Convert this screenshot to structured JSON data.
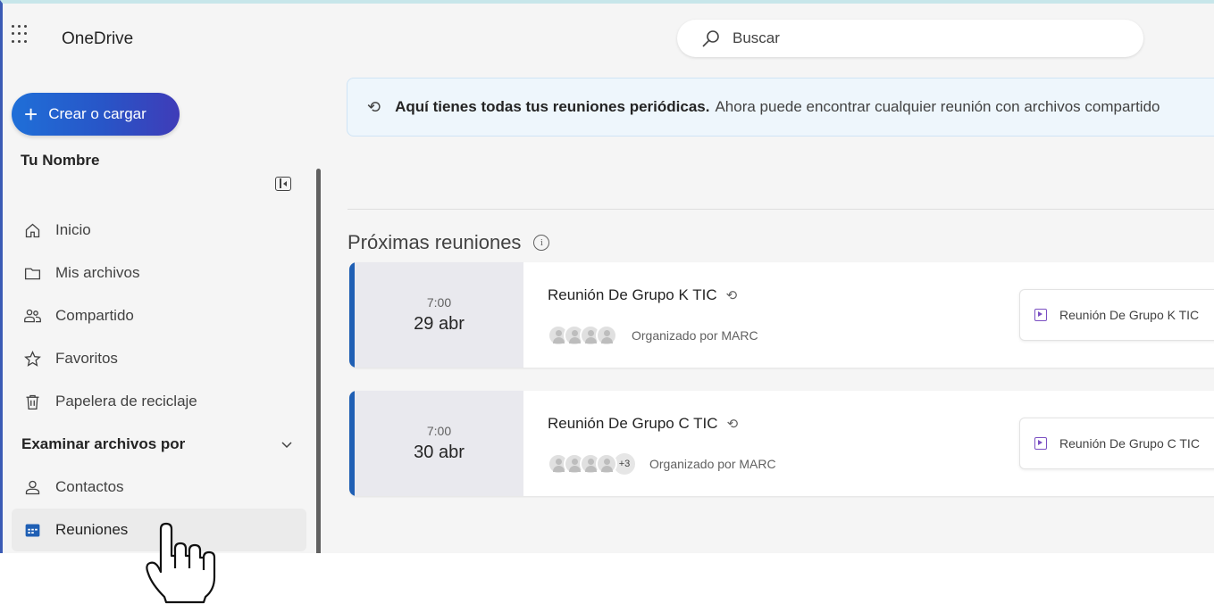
{
  "header": {
    "app_name": "OneDrive",
    "search_placeholder": "Buscar"
  },
  "sidebar": {
    "create_label": "Crear o cargar",
    "user_name": "Tu Nombre",
    "items": [
      {
        "label": "Inicio",
        "icon": "home-icon"
      },
      {
        "label": "Mis archivos",
        "icon": "folder-icon"
      },
      {
        "label": "Compartido",
        "icon": "people-icon"
      },
      {
        "label": "Favoritos",
        "icon": "star-icon"
      },
      {
        "label": "Papelera de reciclaje",
        "icon": "trash-icon"
      }
    ],
    "browse_header": "Examinar archivos por",
    "browse_items": [
      {
        "label": "Contactos",
        "icon": "person-icon"
      },
      {
        "label": "Reuniones",
        "icon": "calendar-icon",
        "active": true
      }
    ]
  },
  "banner": {
    "bold_text": "Aquí tienes todas tus reuniones periódicas.",
    "text": "Ahora puede encontrar cualquier reunión con archivos compartido"
  },
  "meetings_section": {
    "title": "Próximas reuniones"
  },
  "meetings": [
    {
      "time": "7:00",
      "date": "29 abr",
      "title": "Reunión De Grupo K TIC",
      "extra_count": "",
      "organizer": "Organizado por MARC",
      "file": "Reunión De Grupo K TIC"
    },
    {
      "time": "7:00",
      "date": "30 abr",
      "title": "Reunión De Grupo C TIC",
      "extra_count": "+3",
      "organizer": "Organizado por MARC",
      "file": "Reunión De Grupo C TIC"
    }
  ],
  "colors": {
    "accent": "#1f5fb4",
    "create_gradient_start": "#1f6fd8",
    "create_gradient_end": "#3f3cb8"
  }
}
